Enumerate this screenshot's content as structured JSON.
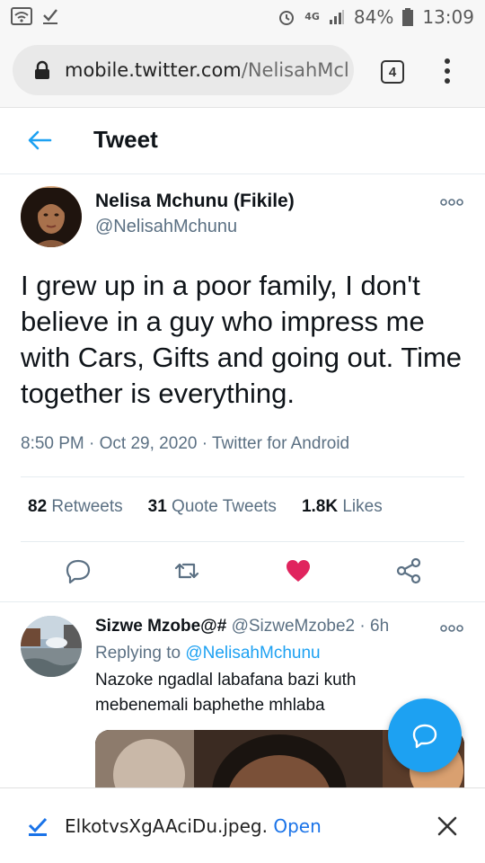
{
  "status_bar": {
    "network": "4G",
    "battery": "84%",
    "time": "13:09"
  },
  "browser": {
    "url_domain": "mobile.twitter.com",
    "url_path": "/NelisahMcl",
    "tab_count": "4"
  },
  "header": {
    "title": "Tweet"
  },
  "tweet": {
    "author_name": "Nelisa Mchunu (Fikile)",
    "author_handle": "@NelisahMchunu",
    "text": "I grew up in a poor family, I don't believe in a guy who impress me with Cars, Gifts and going out. Time together is everything.",
    "time": "8:50 PM",
    "date": "Oct 29, 2020",
    "source": "Twitter for Android",
    "sep": "·",
    "retweets_count": "82",
    "retweets_label": "Retweets",
    "quotes_count": "31",
    "quotes_label": "Quote Tweets",
    "likes_count": "1.8K",
    "likes_label": "Likes"
  },
  "reply": {
    "author_name": "Sizwe Mzobe@#",
    "author_handle": "@SizweMzobe2",
    "sep": "·",
    "age": "6h",
    "replying_label": "Replying to",
    "replying_handle": "@NelisahMchunu",
    "text": "Nazoke ngadlal labafana bazi kuth mebenemali baphethe mhlaba"
  },
  "download": {
    "file_name": "ElkotvsXgAAciDu.jpeg.",
    "open_label": "Open"
  },
  "colors": {
    "accent": "#1da1f2",
    "like": "#e0245e",
    "muted": "#5b7083"
  }
}
